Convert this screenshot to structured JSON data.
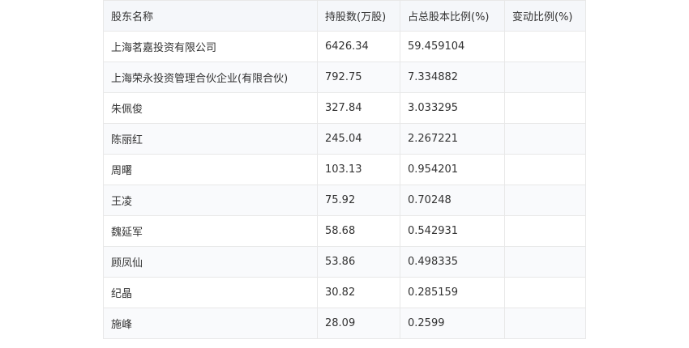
{
  "table": {
    "headers": [
      "股东名称",
      "持股数(万股)",
      "占总股本比例(%)",
      "变动比例(%)"
    ],
    "rows": [
      [
        "上海茗嘉投资有限公司",
        "6426.34",
        "59.459104",
        ""
      ],
      [
        "上海荣永投资管理合伙企业(有限合伙)",
        "792.75",
        "7.334882",
        ""
      ],
      [
        "朱佩俊",
        "327.84",
        "3.033295",
        ""
      ],
      [
        "陈丽红",
        "245.04",
        "2.267221",
        ""
      ],
      [
        "周曙",
        "103.13",
        "0.954201",
        ""
      ],
      [
        "王凌",
        "75.92",
        "0.70248",
        ""
      ],
      [
        "魏延军",
        "58.68",
        "0.542931",
        ""
      ],
      [
        "顾凤仙",
        "53.86",
        "0.498335",
        ""
      ],
      [
        "纪晶",
        "30.82",
        "0.285159",
        ""
      ],
      [
        "施峰",
        "28.09",
        "0.2599",
        ""
      ]
    ]
  }
}
